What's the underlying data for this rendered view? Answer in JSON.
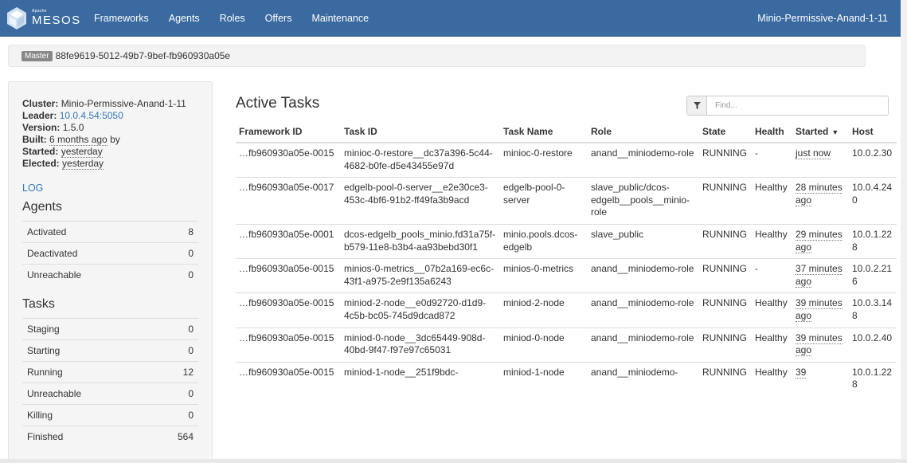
{
  "nav": {
    "brand_small": "Apache",
    "brand": "MESOS",
    "items": [
      "Frameworks",
      "Agents",
      "Roles",
      "Offers",
      "Maintenance"
    ],
    "cluster": "Minio-Permissive-Anand-1-11"
  },
  "master": {
    "label": "Master",
    "id": "88fe9619-5012-49b7-9bef-fb960930a05e"
  },
  "sidebar": {
    "cluster_label": "Cluster:",
    "cluster": "Minio-Permissive-Anand-1-11",
    "leader_label": "Leader:",
    "leader": "10.0.4.54:5050",
    "version_label": "Version:",
    "version": "1.5.0",
    "built_label": "Built:",
    "built": "6 months ago",
    "built_suffix": "by",
    "started_label": "Started:",
    "started": "yesterday",
    "elected_label": "Elected:",
    "elected": "yesterday",
    "log": "LOG",
    "agents_title": "Agents",
    "agents": [
      {
        "label": "Activated",
        "value": "8"
      },
      {
        "label": "Deactivated",
        "value": "0"
      },
      {
        "label": "Unreachable",
        "value": "0"
      }
    ],
    "tasks_title": "Tasks",
    "tasks": [
      {
        "label": "Staging",
        "value": "0"
      },
      {
        "label": "Starting",
        "value": "0"
      },
      {
        "label": "Running",
        "value": "12"
      },
      {
        "label": "Unreachable",
        "value": "0"
      },
      {
        "label": "Killing",
        "value": "0"
      },
      {
        "label": "Finished",
        "value": "564"
      }
    ]
  },
  "main": {
    "title": "Active Tasks",
    "filter_placeholder": "Find...",
    "columns": [
      "Framework ID",
      "Task ID",
      "Task Name",
      "Role",
      "State",
      "Health",
      "Started",
      "Host"
    ],
    "sort_arrow": "▼",
    "rows": [
      {
        "fw": "…fb960930a05e-0015",
        "tid": "minioc-0-restore__dc37a396-5c44-4682-b0fe-d5e43455e97d",
        "name": "minioc-0-restore",
        "role": "anand__miniodemo-role",
        "state": "RUNNING",
        "health": "-",
        "started": "just now",
        "host": "10.0.2.30"
      },
      {
        "fw": "…fb960930a05e-0017",
        "tid": "edgelb-pool-0-server__e2e30ce3-453c-4bf6-91b2-ff49fa3b9acd",
        "name": "edgelb-pool-0-server",
        "role": "slave_public/dcos-edgelb__pools__minio-role",
        "state": "RUNNING",
        "health": "Healthy",
        "started": "28 minutes ago",
        "host": "10.0.4.240"
      },
      {
        "fw": "…fb960930a05e-0001",
        "tid": "dcos-edgelb_pools_minio.fd31a75f-b579-11e8-b3b4-aa93bebd30f1",
        "name": "minio.pools.dcos-edgelb",
        "role": "slave_public",
        "state": "RUNNING",
        "health": "Healthy",
        "started": "29 minutes ago",
        "host": "10.0.1.228"
      },
      {
        "fw": "…fb960930a05e-0015",
        "tid": "minios-0-metrics__07b2a169-ec6c-43f1-a975-2e9f135a6243",
        "name": "minios-0-metrics",
        "role": "anand__miniodemo-role",
        "state": "RUNNING",
        "health": "-",
        "started": "37 minutes ago",
        "host": "10.0.2.216"
      },
      {
        "fw": "…fb960930a05e-0015",
        "tid": "miniod-2-node__e0d92720-d1d9-4c5b-bc05-745d9dcad872",
        "name": "miniod-2-node",
        "role": "anand__miniodemo-role",
        "state": "RUNNING",
        "health": "Healthy",
        "started": "39 minutes ago",
        "host": "10.0.3.148"
      },
      {
        "fw": "…fb960930a05e-0015",
        "tid": "miniod-0-node__3dc65449-908d-40bd-9f47-f97e97c65031",
        "name": "miniod-0-node",
        "role": "anand__miniodemo-role",
        "state": "RUNNING",
        "health": "Healthy",
        "started": "39 minutes ago",
        "host": "10.0.2.40"
      },
      {
        "fw": "…fb960930a05e-0015",
        "tid": "miniod-1-node__251f9bdc-",
        "name": "miniod-1-node",
        "role": "anand__miniodemo-",
        "state": "RUNNING",
        "health": "Healthy",
        "started": "39",
        "host": "10.0.1.228"
      }
    ]
  },
  "colors": {
    "navbar": "#3a6aa0",
    "link": "#337ab7",
    "healthy": "#2ecc40"
  },
  "icons": {
    "logo": "mesos-logo-icon",
    "filter": "filter-icon"
  }
}
